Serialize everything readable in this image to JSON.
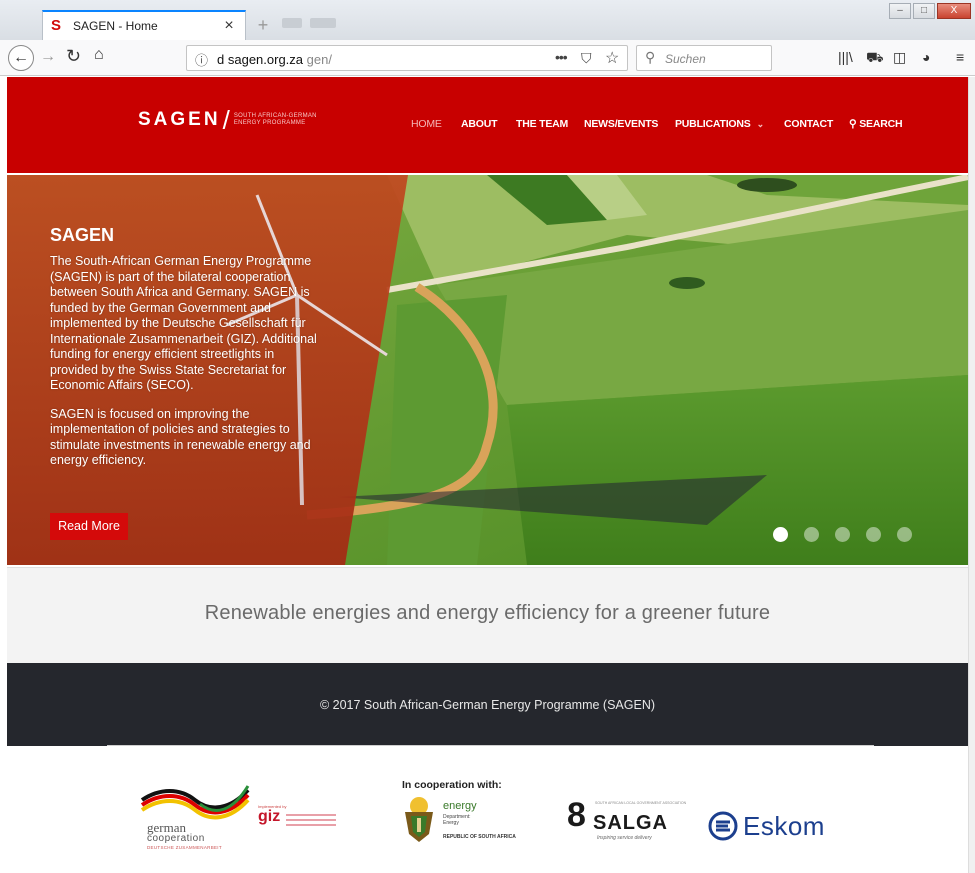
{
  "browser": {
    "tab_title": "SAGEN - Home",
    "tab_favicon": "S",
    "tab_close": "×",
    "new_tab": "+",
    "url_prefix": "d",
    "url_host": "sagen.org.za",
    "url_path": "gen/",
    "url_more": "•••",
    "search_placeholder": "Suchen",
    "win_minimize": "–",
    "win_maximize": "□",
    "win_close": "X"
  },
  "site": {
    "logo_word": "SAGEN",
    "logo_sub_1": "SOUTH AFRICAN-GERMAN",
    "logo_sub_2": "ENERGY PROGRAMME",
    "menu": {
      "home": "HOME",
      "about": "ABOUT",
      "team": "THE TEAM",
      "news": "NEWS/EVENTS",
      "publications": "PUBLICATIONS",
      "contact": "CONTACT",
      "search": "SEARCH"
    }
  },
  "hero": {
    "title": "SAGEN",
    "paragraph_1": "The South-African German Energy Programme (SAGEN) is part of the bilateral cooperation between South Africa and Germany. SAGEN is funded by the German Government and implemented by the Deutsche Gesellschaft für Internationale Zusammenarbeit (GIZ). Additional funding for energy efficient streetlights in provided by the Swiss State Secretariat for Economic Affairs (SECO).",
    "paragraph_2": "SAGEN is focused on improving the implementation of policies and strategies to stimulate investments in renewable energy and energy efficiency.",
    "read_more": "Read More",
    "slide_count": 5,
    "active_slide": 1
  },
  "tagline": "Renewable energies and energy efficiency for a greener future",
  "footer": {
    "copyright": "© 2017 South African-German Energy Programme (SAGEN)"
  },
  "partners": {
    "cooperation_label": "In cooperation with:",
    "german_cooperation_1": "german",
    "german_cooperation_2": "cooperation",
    "german_cooperation_3": "DEUTSCHE ZUSAMMENARBEIT",
    "giz_small": "Implemented by",
    "giz": "giz",
    "energy": "energy",
    "energy_sub_1": "Department:",
    "energy_sub_2": "Energy",
    "energy_rsa": "REPUBLIC OF SOUTH AFRICA",
    "salga_number": "8",
    "salga": "SALGA",
    "salga_top": "SOUTH AFRICAN LOCAL GOVERNMENT ASSOCIATION",
    "salga_tagline": "Inspiring service delivery",
    "eskom": "Eskom"
  },
  "colors": {
    "brand_red": "#c80000",
    "footer_dark": "#25272d"
  }
}
